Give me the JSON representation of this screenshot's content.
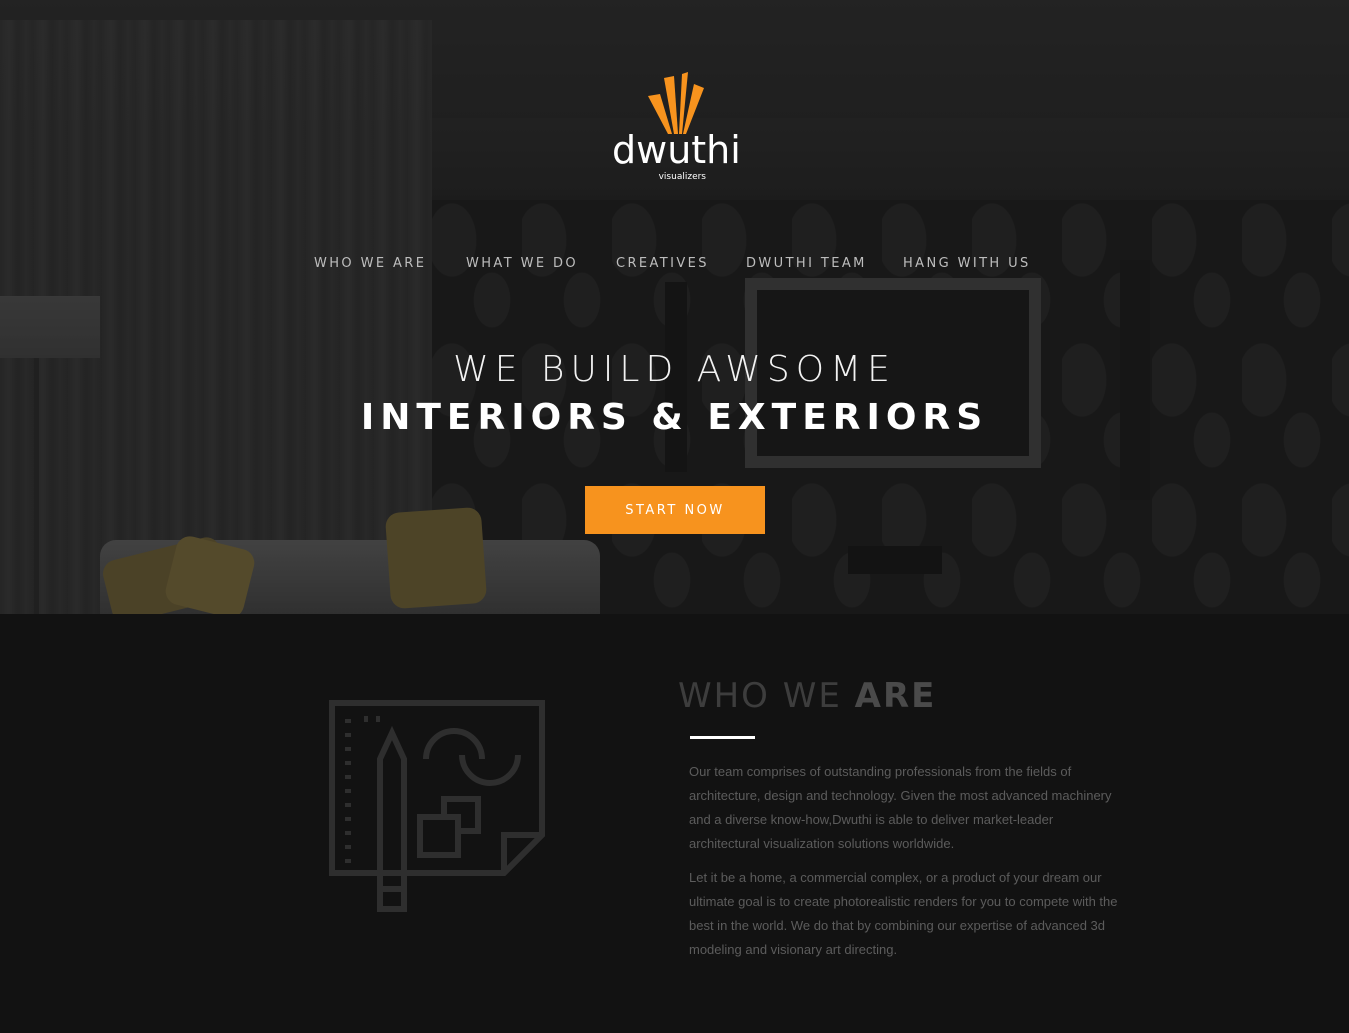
{
  "brand": {
    "name": "dwuthi",
    "tagline": "visualizers",
    "accent_color": "#f7931e"
  },
  "nav": {
    "items": [
      {
        "label": "WHO WE ARE"
      },
      {
        "label": "WHAT WE DO"
      },
      {
        "label": "CREATIVES"
      },
      {
        "label": "DWUTHI TEAM"
      },
      {
        "label": "HANG WITH US"
      }
    ]
  },
  "hero": {
    "headline_line1": "WE BUILD AWSOME",
    "headline_line2": "INTERIORS & EXTERIORS",
    "cta_label": "START NOW"
  },
  "about": {
    "title_light": "WHO WE",
    "title_bold": "ARE",
    "icon": "blueprint-pencil-icon",
    "paragraph1": "Our team comprises of outstanding professionals from the fields of architecture, design and technology. Given the most advanced machinery and a diverse know-how,Dwuthi is able to deliver market-leader architectural visualization solutions worldwide.",
    "paragraph2": "Let it be a home, a commercial complex, or a product of your dream our ultimate goal is to create photorealistic renders for you to compete with the best in the world. We do that by combining our expertise of advanced 3d modeling and visionary art directing."
  }
}
